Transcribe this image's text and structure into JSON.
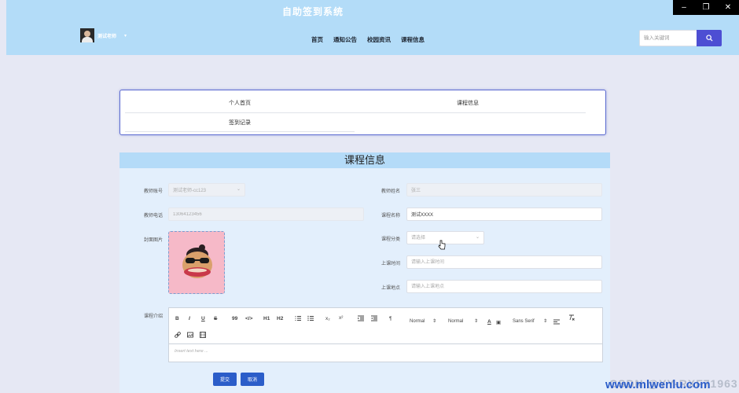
{
  "window": {
    "minimize": "–",
    "maximize": "❐",
    "close": "✕"
  },
  "header": {
    "app_title": "自助签到系统",
    "user_name": "测试老师",
    "user_caret": "▾",
    "nav": [
      "首页",
      "通知公告",
      "校园资讯",
      "课程信息"
    ],
    "search": {
      "placeholder": "输入关键词"
    }
  },
  "tabs": [
    "个人首页",
    "课程信息",
    "签到记录"
  ],
  "form": {
    "title": "课程信息",
    "teacher_account": {
      "label": "教师账号",
      "value": "测试老师-cc123"
    },
    "teacher_name": {
      "label": "教师姓名",
      "value": "张三"
    },
    "teacher_phone": {
      "label": "教师电话",
      "value": "13064123456"
    },
    "course_name": {
      "label": "课程名称",
      "value": "测试XXXX"
    },
    "cover": {
      "label": "封面图片"
    },
    "course_category": {
      "label": "课程分类",
      "placeholder": "请选择"
    },
    "class_time": {
      "label": "上课时间",
      "placeholder": "请输入上课时间"
    },
    "class_place": {
      "label": "上课地点",
      "placeholder": "请输入上课地点"
    },
    "intro": {
      "label": "课程介绍",
      "placeholder": "Insert text here ..."
    },
    "editor": {
      "bold": "B",
      "italic": "I",
      "underline": "U",
      "strike": "S",
      "quote": "99",
      "code": "</>",
      "h1": "H1",
      "h2": "H2",
      "sub": "x₂",
      "sup": "x²",
      "rtl": "¶",
      "size": "Normal",
      "header": "Normal",
      "font": "Sans Serif"
    },
    "submit": "提交",
    "cancel": "取消"
  },
  "watermark": "CSDN @YY-RXF71963",
  "watermark_site": "www.mlwenlu.com"
}
